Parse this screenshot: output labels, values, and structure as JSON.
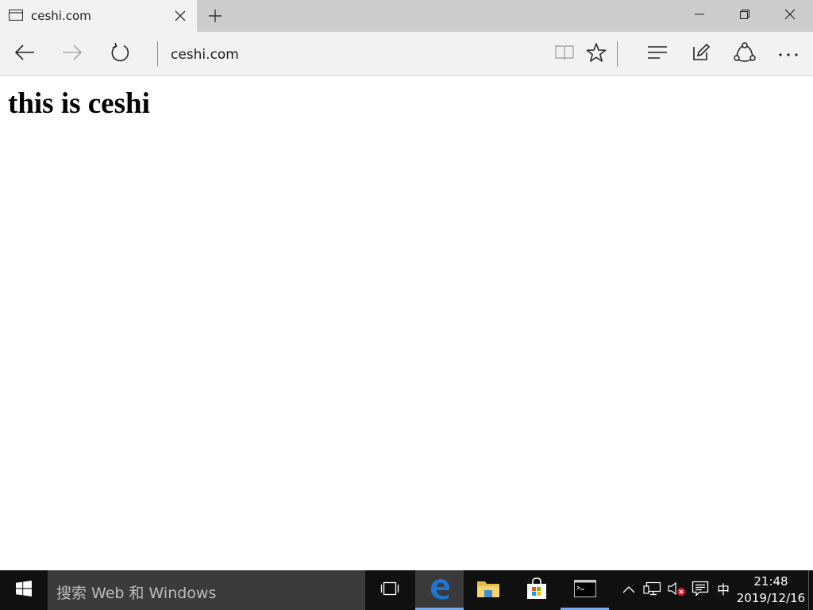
{
  "browser": {
    "tab": {
      "title": "ceshi.com",
      "icon": "page-icon",
      "close_icon": "close-icon"
    },
    "new_tab_icon": "plus-icon",
    "window_controls": [
      "minimize-icon",
      "restore-icon",
      "close-icon"
    ],
    "address": {
      "url": "ceshi.com"
    },
    "nav_icons": [
      "back-arrow-icon",
      "forward-arrow-icon",
      "refresh-icon"
    ],
    "tool_icons": [
      "reading-view-icon",
      "favorite-star-icon",
      "hub-icon",
      "web-note-icon",
      "share-icon",
      "more-icon"
    ]
  },
  "page": {
    "heading": "this is ceshi"
  },
  "taskbar": {
    "search_placeholder": "搜索 Web 和 Windows",
    "apps": [
      "task-view-icon",
      "edge-icon",
      "file-explorer-icon",
      "store-icon",
      "cmd-icon"
    ],
    "active_app": "edge-icon",
    "tray": {
      "icons": [
        "chevron-up-icon",
        "network-icon",
        "volume-muted-icon",
        "action-center-icon"
      ],
      "ime": "中",
      "time": "21:48",
      "date": "2019/12/16"
    }
  },
  "colors": {
    "tab_strip": "#cccccc",
    "toolbar": "#f2f2f2",
    "taskbar": "#101010",
    "search_box": "#3b3b3b",
    "edge_blue": "#1e74d1"
  }
}
